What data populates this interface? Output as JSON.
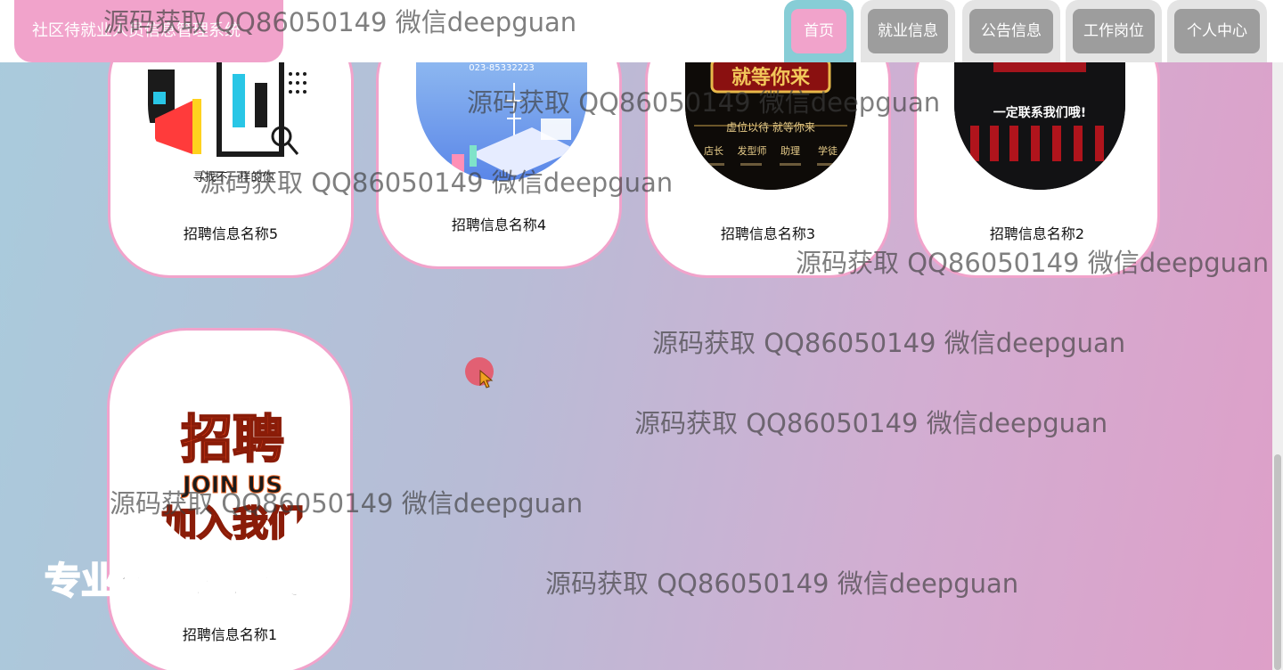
{
  "header": {
    "title": "社区待就业人员信息管理系统"
  },
  "nav": [
    {
      "label": "首页",
      "active": true
    },
    {
      "label": "就业信息",
      "active": false
    },
    {
      "label": "公告信息",
      "active": false
    },
    {
      "label": "工作岗位",
      "active": false
    },
    {
      "label": "个人中心",
      "active": false
    }
  ],
  "cards": [
    {
      "caption": "招聘信息名称5"
    },
    {
      "caption": "招聘信息名称4"
    },
    {
      "caption": "招聘信息名称3"
    },
    {
      "caption": "招聘信息名称2"
    },
    {
      "caption": "招聘信息名称1"
    }
  ],
  "poster_text": {
    "p3_title": "就等你来",
    "p3_sub": "虚位以待 就等你来",
    "p3_roles": [
      "店长",
      "发型师",
      "助理",
      "学徒"
    ],
    "p2_title": "一定联系我们哦!",
    "p1_title": "招聘",
    "p1_join": "JOIN US",
    "p1_bottom": "加入我们",
    "p4_phone": "023-85332223",
    "p5_text": "寻找不一样的你"
  },
  "promo": "专业毕业设计代做",
  "watermark": "源码获取 QQ86050149 微信deepguan",
  "colors": {
    "pink": "#f1a3cb",
    "teal": "#87cdd6",
    "gray": "#9d9d9d"
  }
}
